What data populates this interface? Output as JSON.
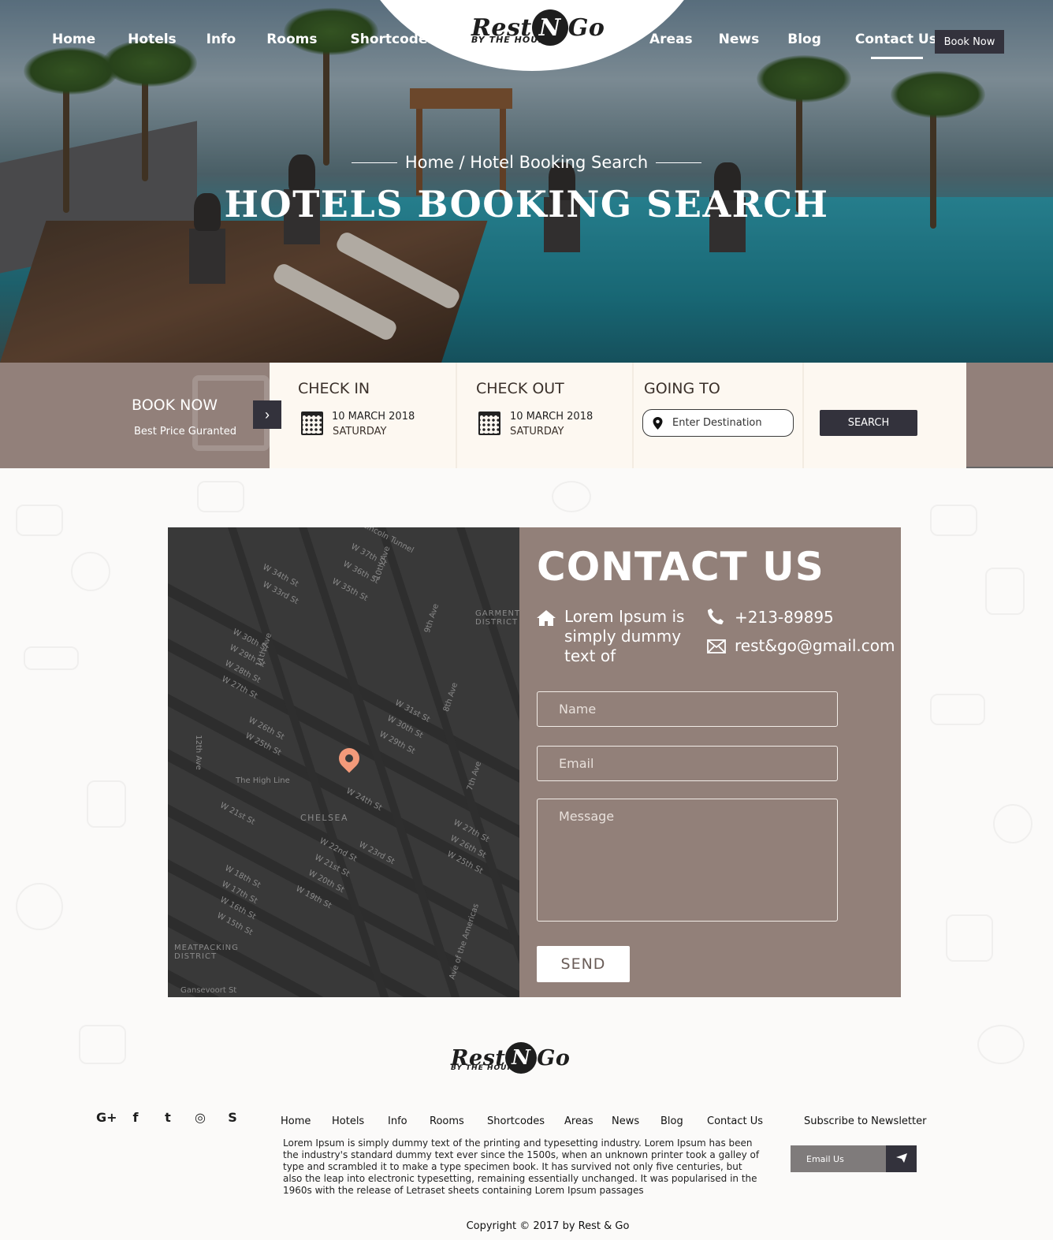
{
  "header": {
    "brand": {
      "name_part1": "Rest",
      "name_mid": "N",
      "name_part2": "Go",
      "tagline": "BY THE HOUR"
    },
    "nav_left": [
      "Home",
      "Hotels",
      "Info",
      "Rooms",
      "Shortcodes"
    ],
    "nav_right": [
      "Areas",
      "News",
      "Blog",
      "Contact Us"
    ],
    "active_item": "Contact Us",
    "book_now_label": "Book Now"
  },
  "hero": {
    "breadcrumb": "Home / Hotel Booking Search",
    "title": "HOTELS BOOKING SEARCH"
  },
  "booking": {
    "title": "BOOK NOW",
    "subtitle": "Best Price Guranted",
    "check_in": {
      "label": "CHECK IN",
      "date": "10 MARCH 2018",
      "day": "SATURDAY"
    },
    "check_out": {
      "label": "CHECK OUT",
      "date": "10 MARCH 2018",
      "day": "SATURDAY"
    },
    "going_to": {
      "label": "GOING TO",
      "placeholder": "Enter Destination"
    },
    "search_label": "SEARCH"
  },
  "map": {
    "streets": [
      "W 34th St",
      "W 33rd St",
      "W 37th St",
      "W 36th St",
      "W 35th St",
      "W 30th St",
      "W 29th St",
      "W 28th St",
      "W 27th St",
      "W 26th St",
      "W 25th St",
      "W 31st St",
      "W 30th St",
      "W 29th St",
      "W 24th St",
      "W 21st St",
      "W 22nd St",
      "W 21st St",
      "W 20th St",
      "W 19th St",
      "W 18th St",
      "W 17th St",
      "W 16th St",
      "W 15th St",
      "W 23rd St",
      "W 27th St",
      "W 26th St",
      "W 25th St"
    ],
    "avenues": [
      "10th Ave",
      "11th Ave",
      "9th Ave",
      "8th Ave",
      "7th Ave",
      "12th Ave",
      "Ave of the Americas"
    ],
    "areas": [
      "GARMENT DISTRICT",
      "CHELSEA",
      "The High Line",
      "MEATPACKING DISTRICT",
      "Gansevoort St",
      "Lincoln Tunnel"
    ]
  },
  "contact": {
    "title": "CONTACT US",
    "address": "Lorem Ipsum is simply dummy text of",
    "phone": "+213-89895",
    "email": "rest&go@gmail.com",
    "form": {
      "name_placeholder": "Name",
      "email_placeholder": "Email",
      "message_placeholder": "Message",
      "send_label": "SEND"
    }
  },
  "footer": {
    "social_icons": [
      "google-plus-icon",
      "facebook-icon",
      "twitter-icon",
      "instagram-icon",
      "skype-icon"
    ],
    "social_glyphs": [
      "G+",
      "f",
      "t",
      "◎",
      "S"
    ],
    "nav": [
      "Home",
      "Hotels",
      "Info",
      "Rooms",
      "Shortcodes",
      "Areas",
      "News",
      "Blog",
      "Contact Us"
    ],
    "description": "Lorem Ipsum is simply dummy text of the printing and typesetting industry. Lorem Ipsum has been the industry's standard dummy text ever since the 1500s, when an unknown printer took a galley of type and scrambled it to make a type specimen book. It has survived not only five centuries, but also the leap into electronic typesetting, remaining essentially unchanged. It was popularised in the 1960s with the release of Letraset sheets containing Lorem Ipsum passages",
    "newsletter_title": "Subscribe to Newsletter",
    "newsletter_placeholder": "Email Us",
    "copyright": "Copyright © 2017 by Rest & Go"
  },
  "colors": {
    "accent_dark": "#33323c",
    "taupe": "#928079",
    "cream": "#fdf8f1",
    "marker": "#f39a7a"
  }
}
